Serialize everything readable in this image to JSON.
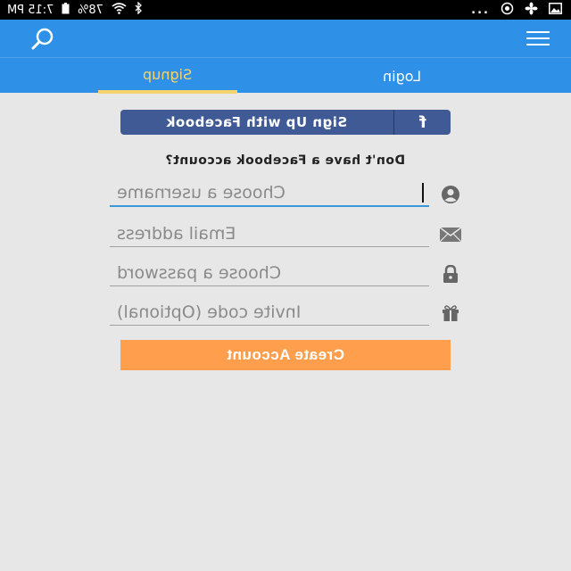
{
  "status_bar": {
    "time": "7:15 PM",
    "battery": "78%",
    "overflow_dots": "..."
  },
  "app_bar": {
    "search_icon": "search-icon",
    "menu_icon": "hamburger-menu-icon"
  },
  "tabs": [
    {
      "label": "Signup",
      "active": true
    },
    {
      "label": "Login",
      "active": false
    }
  ],
  "facebook_button": {
    "label": "Sign Up with Facebook",
    "icon_glyph": "f"
  },
  "no_facebook_text": "Don't have a Facebook account?",
  "form": {
    "username": {
      "placeholder": "Choose a username",
      "value": "",
      "icon": "user-icon"
    },
    "email": {
      "placeholder": "Email address",
      "value": "",
      "icon": "envelope-icon"
    },
    "password": {
      "placeholder": "Choose a password",
      "value": "",
      "icon": "lock-icon"
    },
    "invite": {
      "placeholder": "Invite code (Optional)",
      "value": "",
      "icon": "gift-icon"
    }
  },
  "create_button": {
    "label": "Create Account"
  },
  "colors": {
    "primary": "#2e90e6",
    "active_tab": "#f5d36e",
    "facebook": "#3f5a94",
    "cta": "#ff9f4d",
    "background": "#e7e7e7"
  }
}
